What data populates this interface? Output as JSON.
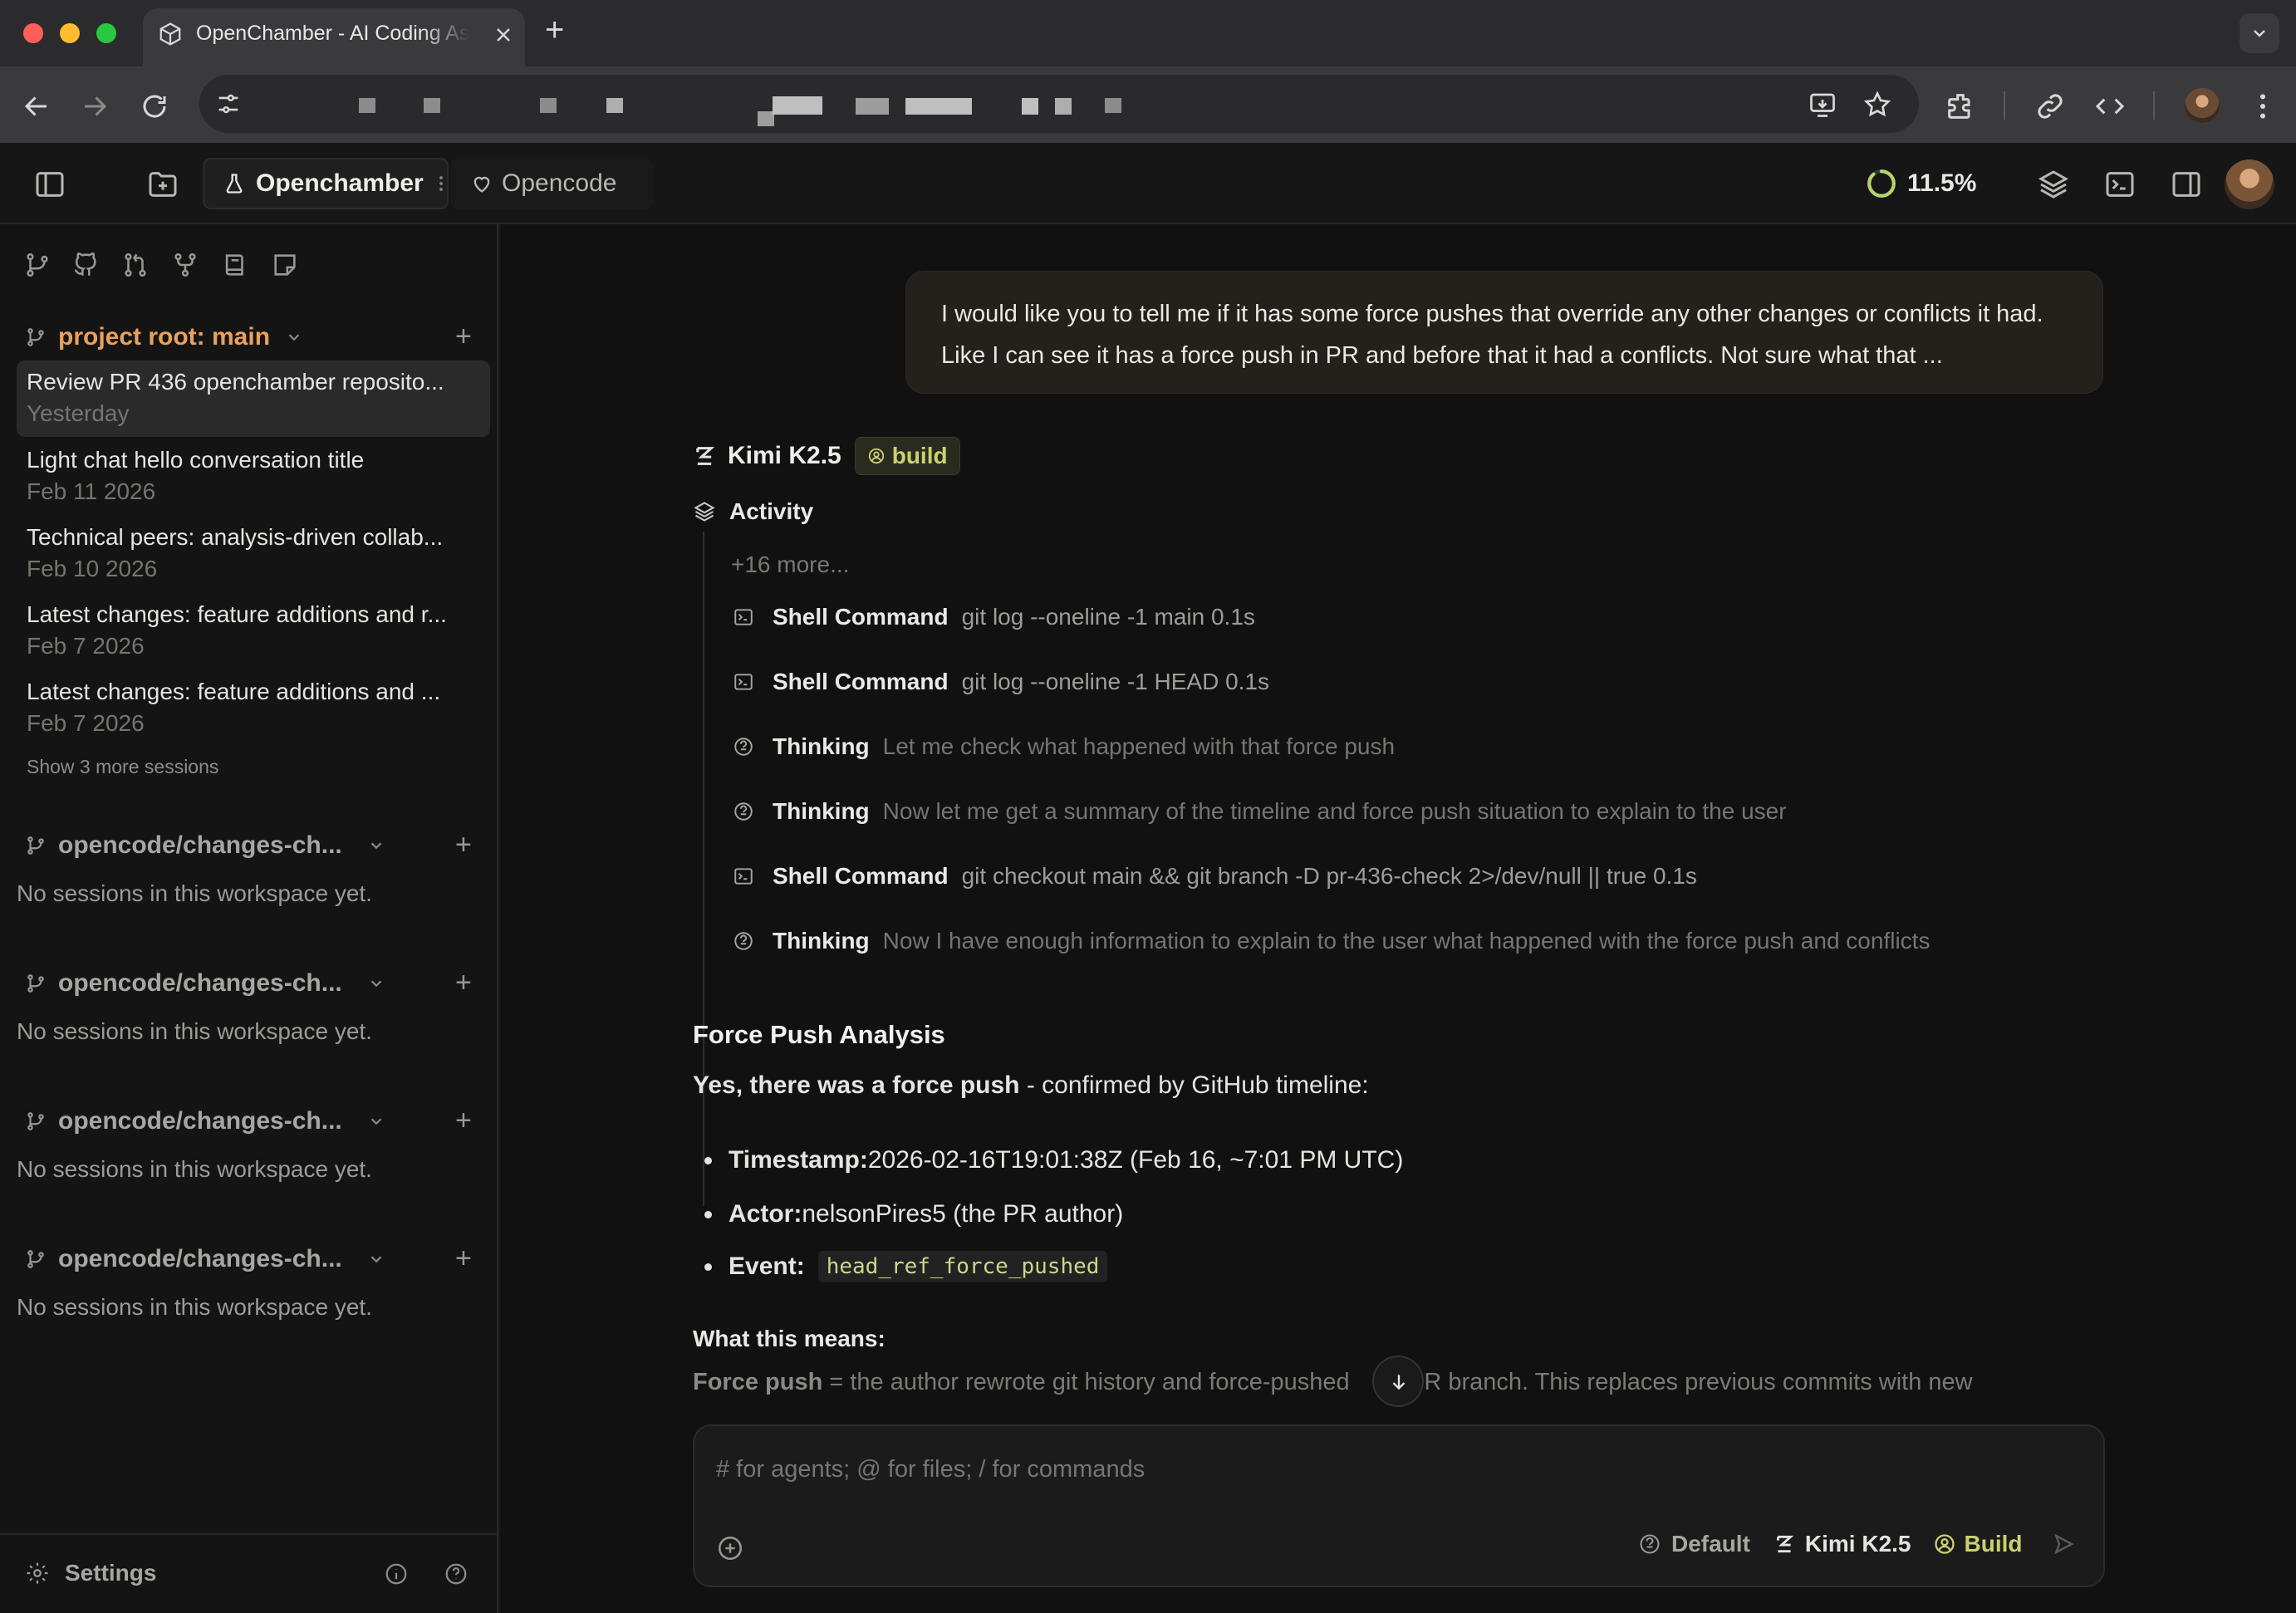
{
  "browser": {
    "tab_title": "OpenChamber - AI Coding Assistant",
    "new_tab_label": "+"
  },
  "app": {
    "tabs": [
      {
        "label": "Openchamber",
        "icon": "flask-icon"
      },
      {
        "label": "Opencode",
        "icon": "heart-icon"
      }
    ],
    "usage": "11.5%"
  },
  "sidebar": {
    "root_workspace": {
      "title": "project root: main",
      "sessions": [
        {
          "title": "Review PR 436 opencham­ber reposito...",
          "date": "Yesterday"
        },
        {
          "title": "Light chat hello conversation title",
          "date": "Feb 11 2026"
        },
        {
          "title": "Technical peers: analysis-driven collab...",
          "date": "Feb 10 2026"
        },
        {
          "title": "Latest changes: feature additions and r...",
          "date": "Feb 7 2026"
        },
        {
          "title": "Latest changes: feature additions and ...",
          "date": "Feb 7 2026"
        }
      ],
      "show_more": "Show 3 more sessions"
    },
    "workspaces": [
      {
        "title": "opencode/changes-ch...",
        "empty": "No sessions in this workspace yet."
      },
      {
        "title": "opencode/changes-ch...",
        "empty": "No sessions in this workspace yet."
      },
      {
        "title": "opencode/changes-ch...",
        "empty": "No sessions in this workspace yet."
      },
      {
        "title": "opencode/changes-ch...",
        "empty": "No sessions in this workspace yet."
      }
    ],
    "settings_label": "Settings"
  },
  "chat": {
    "user_message": "I would like you to tell me if it has some force pushes that override any other changes or conflicts it had. Like I can see it has a force push in PR and before that it had a conflicts. Not sure what that ...",
    "assistant": {
      "model": "Kimi K2.5",
      "mode_badge": "build",
      "activity_label": "Activity",
      "more": "+16 more...",
      "steps": [
        {
          "type": "shell",
          "name": "Shell Command",
          "detail": "git log --oneline -1 main 0.1s"
        },
        {
          "type": "shell",
          "name": "Shell Command",
          "detail": "git log --oneline -1 HEAD 0.1s"
        },
        {
          "type": "thinking",
          "name": "Thinking",
          "detail": "Let me check what happened with that force push"
        },
        {
          "type": "thinking",
          "name": "Thinking",
          "detail": "Now let me get a summary of the timeline and force push situation to explain to the user"
        },
        {
          "type": "shell",
          "name": "Shell Command",
          "detail": "git checkout main && git branch -D pr-436-check 2>/dev/null || true 0.1s"
        },
        {
          "type": "thinking",
          "name": "Thinking",
          "detail": "Now I have enough information to explain to the user what happened with the force push and conflicts"
        }
      ],
      "heading": "Force Push Analysis",
      "summary_bold": "Yes, there was a force push",
      "summary_rest": " - confirmed by GitHub timeline:",
      "bullets": [
        {
          "label": "Timestamp:",
          "value": " 2026-02-16T19:01:38Z (Feb 16, ~7:01 PM UTC)"
        },
        {
          "label": "Actor:",
          "value": " nelsonPires5 (the PR author)"
        },
        {
          "label": "Event:",
          "code": "head_ref_force_pushed"
        }
      ],
      "subheading": "What this means:",
      "trailing_bold": "Force push",
      "trailing_a": " = the author rewrote git history and force-pushed",
      "trailing_b": "he PR branch. This replaces previous commits with new"
    },
    "composer": {
      "placeholder": "# for agents; @ for files; / for commands",
      "variant": "Default",
      "model": "Kimi K2.5",
      "mode": "Build"
    }
  },
  "colors": {
    "accent_orange": "#e8a15c",
    "build_green": "#c9d16f",
    "usage_green": "#b7d36b"
  }
}
